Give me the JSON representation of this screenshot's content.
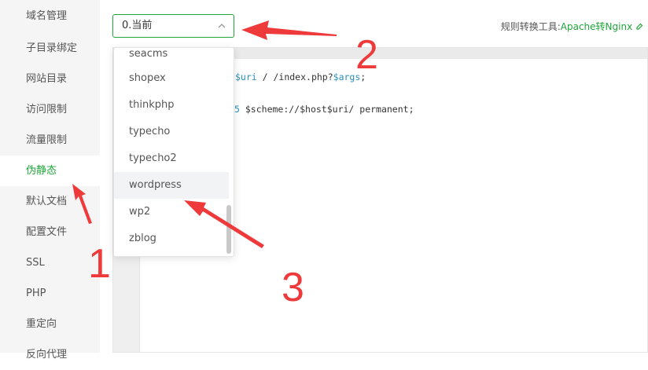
{
  "sidebar": {
    "items": [
      {
        "label": "域名管理"
      },
      {
        "label": "子目录绑定"
      },
      {
        "label": "网站目录"
      },
      {
        "label": "访问限制"
      },
      {
        "label": "流量限制"
      },
      {
        "label": "伪静态",
        "active": true
      },
      {
        "label": "默认文档"
      },
      {
        "label": "配置文件"
      },
      {
        "label": "SSL"
      },
      {
        "label": "PHP"
      },
      {
        "label": "重定向"
      },
      {
        "label": "反向代理"
      }
    ]
  },
  "rewrite_select": {
    "value": "0.当前",
    "options": [
      "seacms",
      "shopex",
      "thinkphp",
      "typecho",
      "typecho2",
      "wordpress",
      "wp2",
      "zblog"
    ],
    "highlighted": "wordpress"
  },
  "tool": {
    "label": "规则转换工具:",
    "link": "Apache转Nginx"
  },
  "editor": {
    "line1_var1": "$uri",
    "line1_mid": "/ /index.php?",
    "line1_var2": "$args",
    "line1_end": ";",
    "line2": "$scheme://$host$uri/ permanent;",
    "line2_prefix": "5"
  },
  "annotations": [
    "1",
    "2",
    "3"
  ],
  "colors": {
    "accent": "#20a53a",
    "annotation": "#ee3a3a"
  }
}
